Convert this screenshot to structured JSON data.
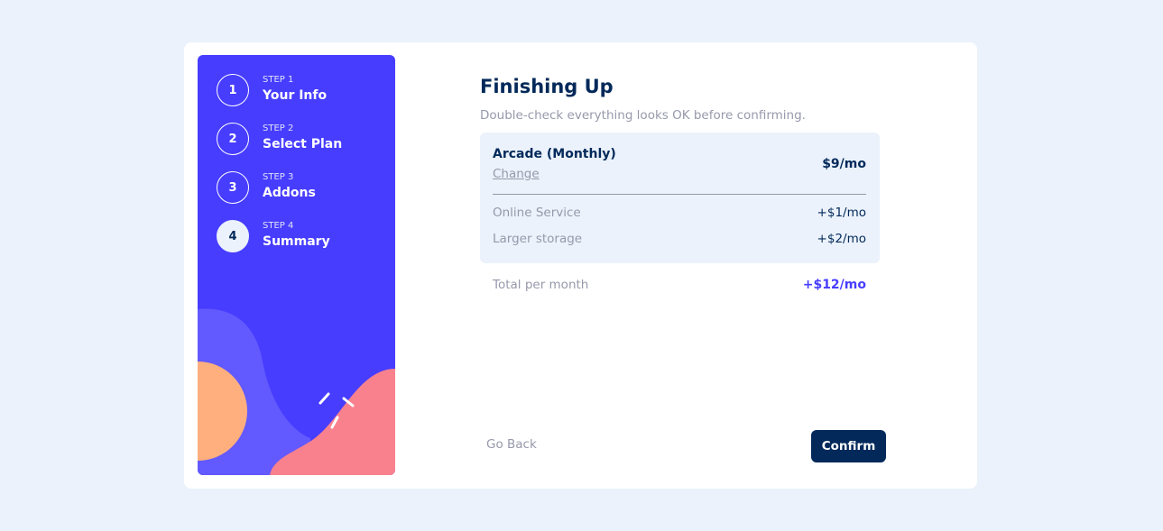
{
  "sidebar": {
    "steps": [
      {
        "number": "1",
        "label": "STEP 1",
        "name": "Your Info"
      },
      {
        "number": "2",
        "label": "STEP 2",
        "name": "Select Plan"
      },
      {
        "number": "3",
        "label": "STEP 3",
        "name": "Addons"
      },
      {
        "number": "4",
        "label": "STEP 4",
        "name": "Summary"
      }
    ],
    "active_step": 4
  },
  "main": {
    "title": "Finishing Up",
    "subtitle": "Double-check everything looks OK before confirming.",
    "plan": {
      "name": "Arcade (Monthly)",
      "change_label": "Change",
      "price": "$9/mo"
    },
    "addons": [
      {
        "name": "Online Service",
        "price": "+$1/mo"
      },
      {
        "name": "Larger storage",
        "price": "+$2/mo"
      }
    ],
    "total": {
      "label": "Total per month",
      "price": "+$12/mo"
    }
  },
  "footer": {
    "back_label": "Go Back",
    "confirm_label": "Confirm"
  },
  "colors": {
    "page_bg": "#ebf2fb",
    "sidebar_bg": "#473dff",
    "primary_text": "#02295a",
    "muted_text": "#9699ab",
    "accent": "#473dff",
    "button_bg": "#02295a",
    "blob_light": "#6259ff",
    "blob_orange": "#ffaf7e",
    "blob_pink": "#f9818e"
  }
}
